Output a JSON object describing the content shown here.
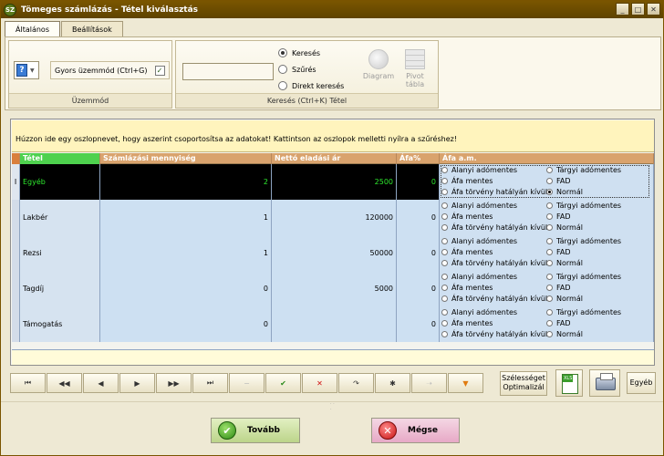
{
  "window": {
    "title": "Tömeges számlázás - Tétel kiválasztás",
    "app_icon_text": "SZ",
    "controls": {
      "minimize": "_",
      "maximize": "□",
      "close": "✕"
    }
  },
  "tabs": [
    {
      "label": "Általános",
      "active": true
    },
    {
      "label": "Beállítások",
      "active": false
    }
  ],
  "ribbon": {
    "mode_group": {
      "label": "Üzemmód",
      "fast_mode_label": "Gyors üzemmód (Ctrl+G)",
      "fast_mode_checked": true,
      "mode_icon": "question-mark-icon"
    },
    "search_group": {
      "label": "Keresés (Ctrl+K) Tétel",
      "search_value": "",
      "radio_options": [
        {
          "label": "Keresés",
          "checked": true
        },
        {
          "label": "Szűrés",
          "checked": false
        },
        {
          "label": "Direkt keresés",
          "checked": false
        }
      ],
      "diagram_label": "Diagram",
      "pivot_label": "Pivot\ntábla"
    }
  },
  "grid": {
    "grouping_hint": "Húzzon ide egy oszlopnevet, hogy aszerint csoportosítsa az adatokat! Kattintson az oszlopok melletti nyílra a szűréshez!",
    "columns": [
      "Tétel",
      "Számlázási mennyiség",
      "Nettó eladási ár",
      "Áfa%",
      "Áfa a.m."
    ],
    "vat_options": [
      "Alanyi adómentes",
      "Tárgyi adómentes",
      "Áfa mentes",
      "FAD",
      "Áfa törvény hatályán kívül",
      "Normál"
    ],
    "rows": [
      {
        "indicator": "I",
        "item": "Egyéb",
        "qty": "2",
        "price": "2500",
        "vat": "0",
        "selected_vat": "Normál",
        "selected": true
      },
      {
        "indicator": "",
        "item": "Lakbér",
        "qty": "1",
        "price": "120000",
        "vat": "0",
        "selected_vat": "",
        "selected": false
      },
      {
        "indicator": "",
        "item": "Rezsi",
        "qty": "1",
        "price": "50000",
        "vat": "0",
        "selected_vat": "",
        "selected": false
      },
      {
        "indicator": "",
        "item": "Tagdíj",
        "qty": "0",
        "price": "5000",
        "vat": "0",
        "selected_vat": "",
        "selected": false
      },
      {
        "indicator": "",
        "item": "Támogatás",
        "qty": "0",
        "price": "",
        "vat": "0",
        "selected_vat": "",
        "selected": false
      }
    ]
  },
  "navigator": {
    "buttons": [
      {
        "name": "first-page",
        "glyph": "⏮",
        "style": ""
      },
      {
        "name": "prev-page",
        "glyph": "◀◀",
        "style": ""
      },
      {
        "name": "prev-record",
        "glyph": "◀",
        "style": ""
      },
      {
        "name": "next-record",
        "glyph": "▶",
        "style": ""
      },
      {
        "name": "next-page",
        "glyph": "▶▶",
        "style": ""
      },
      {
        "name": "last-page",
        "glyph": "⏭",
        "style": ""
      },
      {
        "name": "delete",
        "glyph": "−",
        "style": "dis"
      },
      {
        "name": "post",
        "glyph": "✔",
        "style": "green"
      },
      {
        "name": "cancel-edit",
        "glyph": "✕",
        "style": "red"
      },
      {
        "name": "refresh",
        "glyph": "↷",
        "style": ""
      },
      {
        "name": "bookmark",
        "glyph": "✱",
        "style": ""
      },
      {
        "name": "goto-bookmark",
        "glyph": "➝",
        "style": "dis"
      },
      {
        "name": "filter",
        "glyph": "▼",
        "style": "orange"
      }
    ]
  },
  "tools": {
    "optimize_width_label": "Szélességet\nOptimalizál",
    "other_label": "Egyéb"
  },
  "actions": {
    "next_label": "Tovább",
    "cancel_label": "Mégse"
  }
}
